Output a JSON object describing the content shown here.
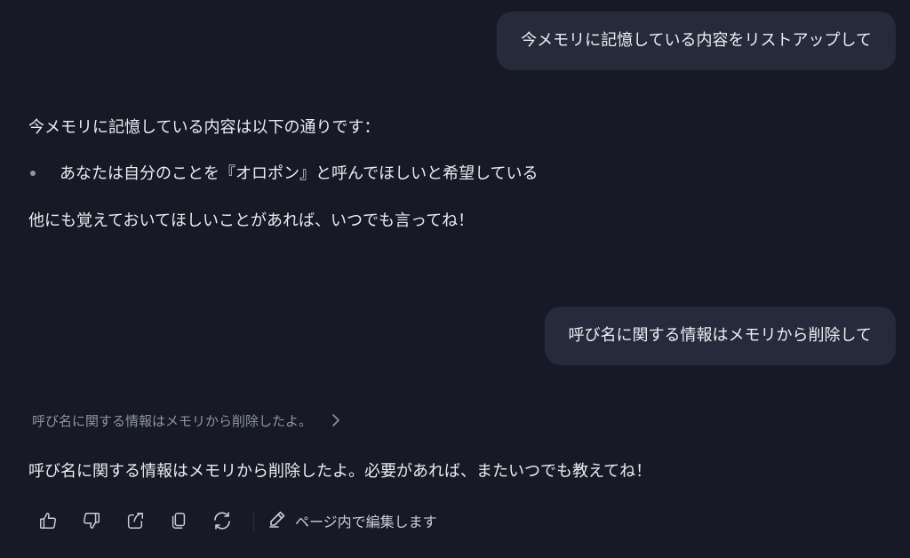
{
  "messages": {
    "user_1": "今メモリに記憶している内容をリストアップして",
    "assistant_1": {
      "intro": "今メモリに記憶している内容は以下の通りです：",
      "bullets": [
        "あなたは自分のことを『オロポン』と呼んでほしいと希望している"
      ],
      "outro": "他にも覚えておいてほしいことがあれば、いつでも言ってね！"
    },
    "user_2": "呼び名に関する情報はメモリから削除して",
    "assistant_2": {
      "status": "呼び名に関する情報はメモリから削除したよ。",
      "text": "呼び名に関する情報はメモリから削除したよ。必要があれば、またいつでも教えてね！"
    }
  },
  "toolbar": {
    "icons": [
      "thumbs-up-icon",
      "thumbs-down-icon",
      "share-icon",
      "copy-icon",
      "regenerate-icon",
      "edit-icon"
    ],
    "edit_label": "ページ内で編集します"
  },
  "colors": {
    "background": "#171a26",
    "user_bubble": "#262b3b",
    "text": "#e9ebf0",
    "muted": "#8e93a3"
  }
}
